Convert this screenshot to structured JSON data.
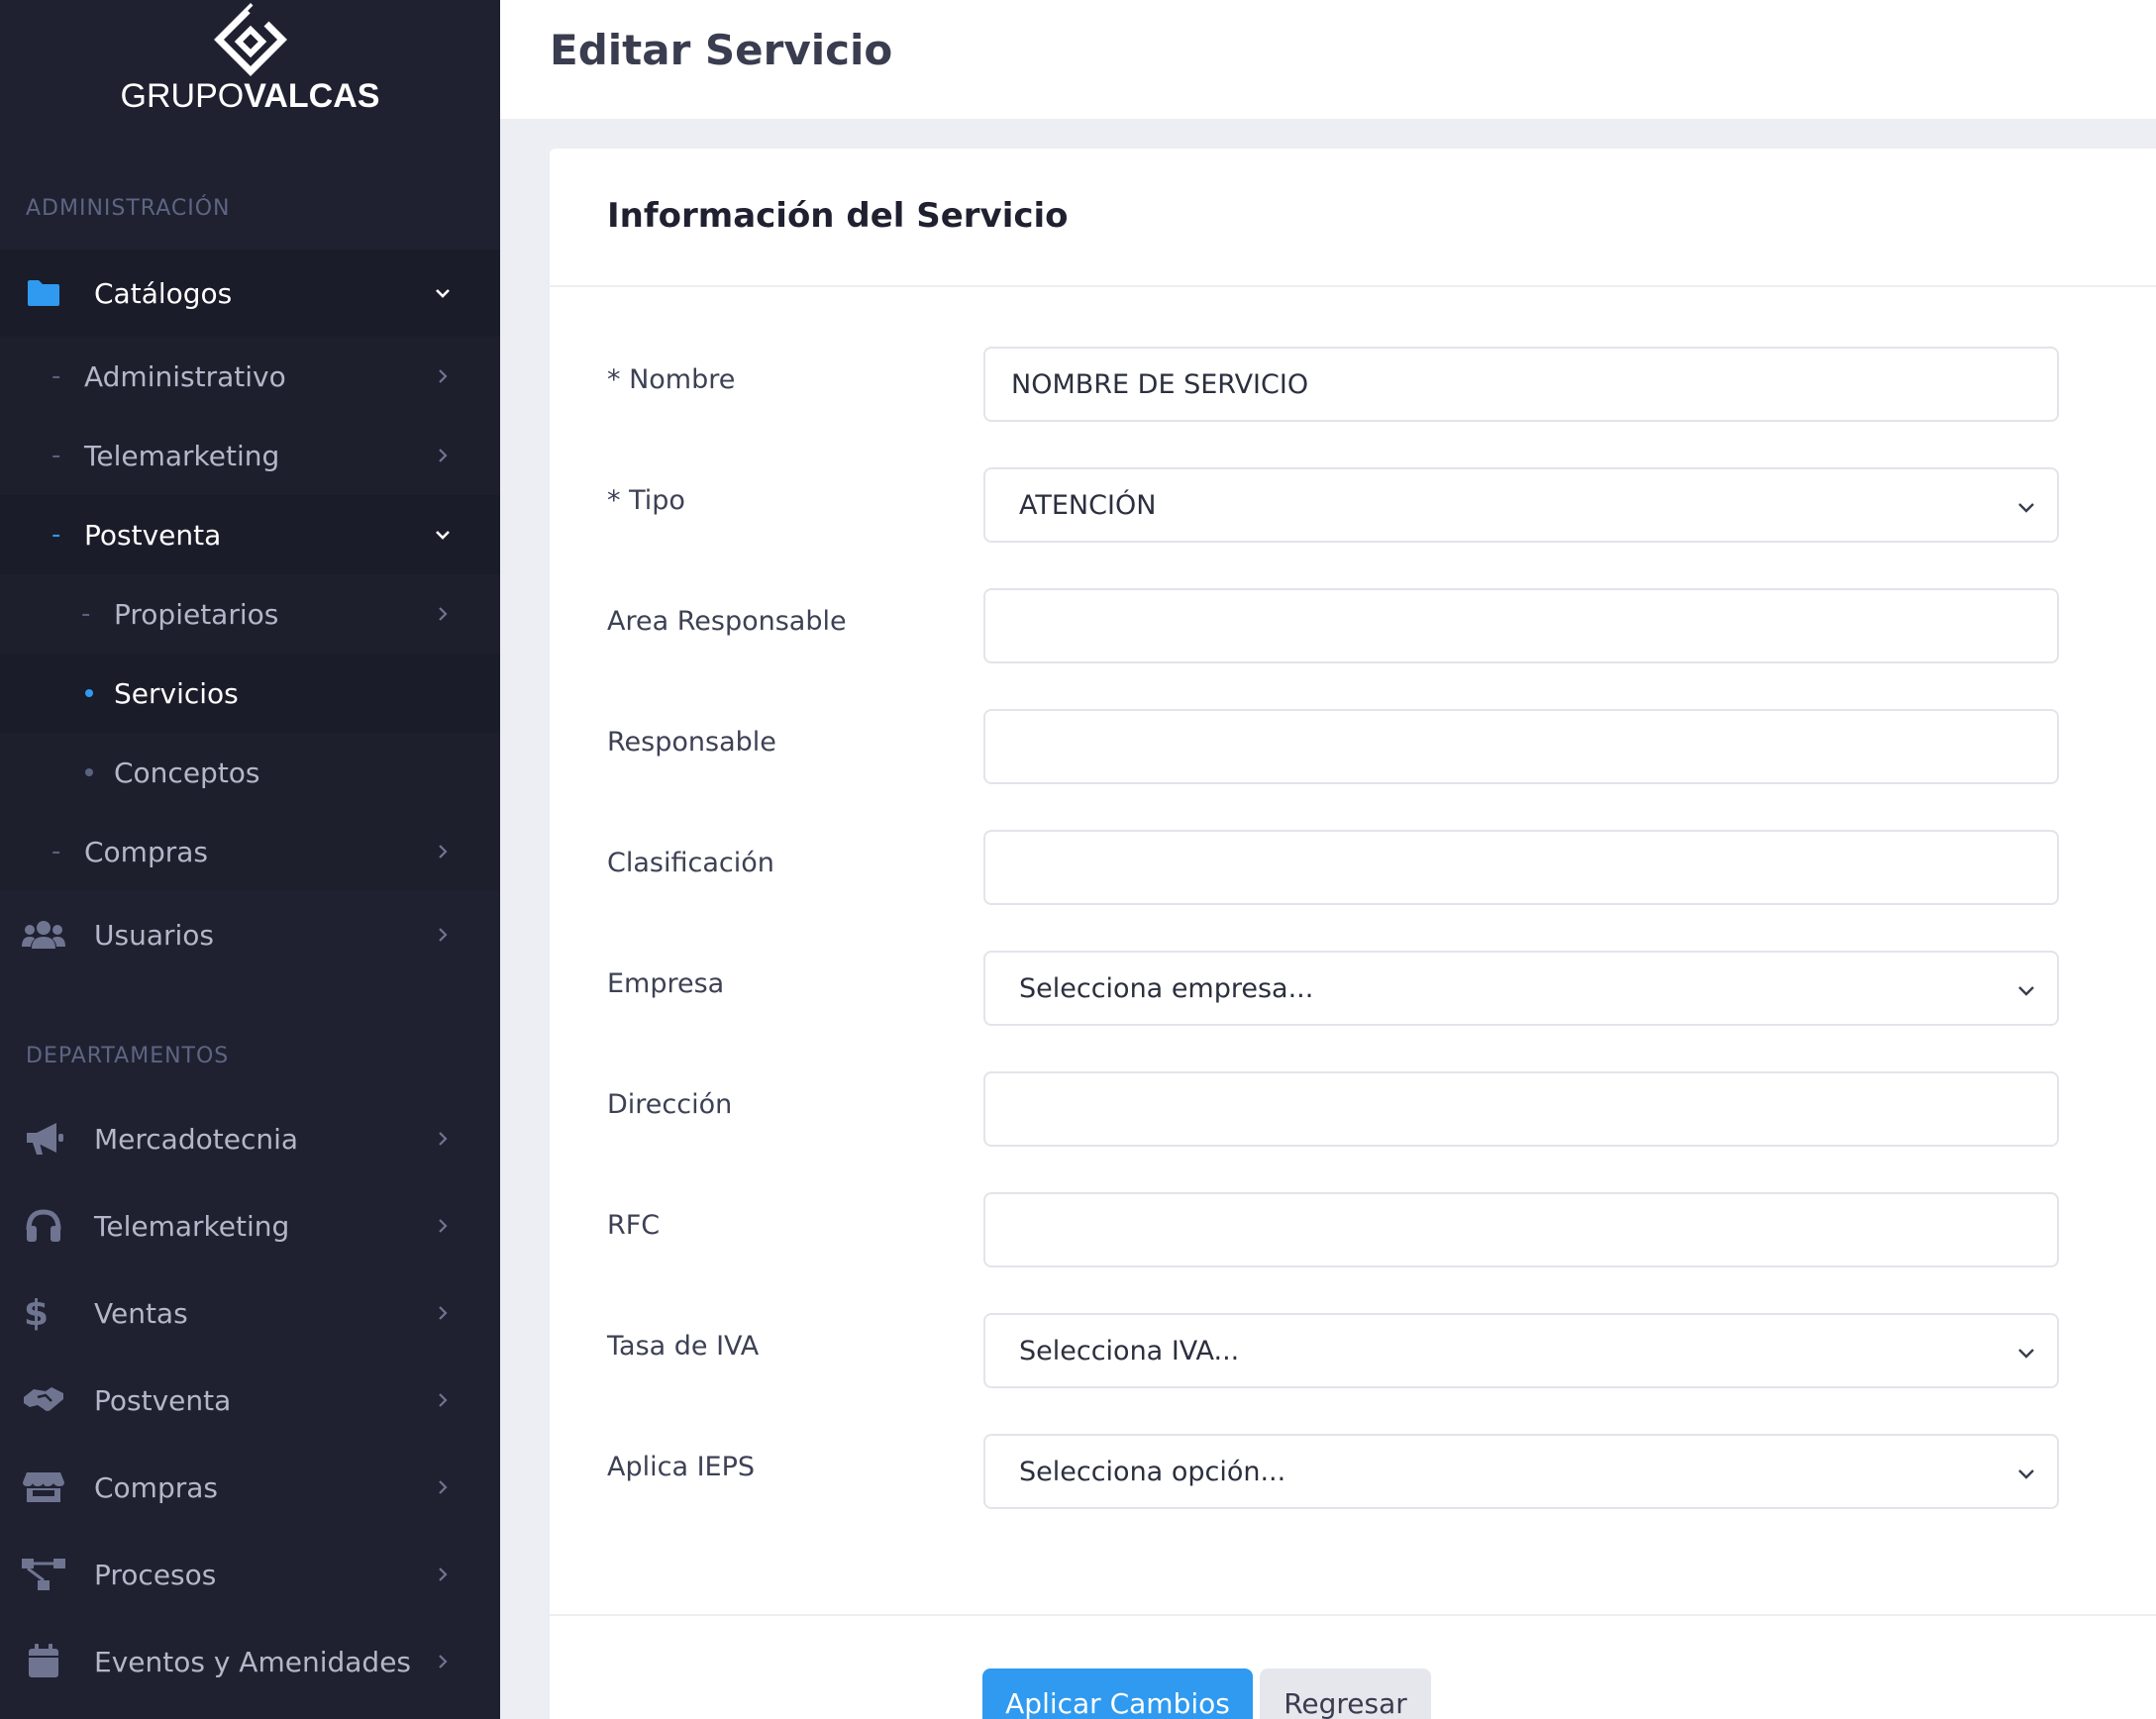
{
  "brand": {
    "name_light": "GRUPO",
    "name_bold": "VALCAS"
  },
  "sidebar": {
    "section_admin": "ADMINISTRACIÓN",
    "section_departments": "DEPARTAMENTOS",
    "catalogos": "Catálogos",
    "administrativo": "Administrativo",
    "telemarketing_sub": "Telemarketing",
    "postventa_sub": "Postventa",
    "propietarios": "Propietarios",
    "servicios": "Servicios",
    "conceptos": "Conceptos",
    "compras_sub": "Compras",
    "usuarios": "Usuarios",
    "mercadotecnia": "Mercadotecnia",
    "telemarketing": "Telemarketing",
    "ventas": "Ventas",
    "postventa": "Postventa",
    "compras": "Compras",
    "procesos": "Procesos",
    "eventos": "Eventos y Amenidades"
  },
  "header": {
    "title": "Editar Servicio"
  },
  "card": {
    "title": "Información del Servicio"
  },
  "form": {
    "nombre_label": "* Nombre",
    "nombre_value": "NOMBRE DE SERVICIO",
    "tipo_label": "* Tipo",
    "tipo_value": "ATENCIÓN",
    "area_label": "Area Responsable",
    "area_value": "",
    "responsable_label": "Responsable",
    "responsable_value": "",
    "clasificacion_label": "Clasificación",
    "clasificacion_value": "",
    "empresa_label": "Empresa",
    "empresa_value": "Selecciona empresa...",
    "direccion_label": "Dirección",
    "direccion_value": "",
    "rfc_label": "RFC",
    "rfc_value": "",
    "iva_label": "Tasa de IVA",
    "iva_value": "Selecciona IVA...",
    "ieps_label": "Aplica IEPS",
    "ieps_value": "Selecciona opción..."
  },
  "buttons": {
    "apply": "Aplicar Cambios",
    "back": "Regresar"
  },
  "colors": {
    "sidebar_bg": "#1f2130",
    "accent": "#2f9af0",
    "page_bg": "#eceef4"
  },
  "icons": {
    "catalogos": "folder-icon",
    "usuarios": "users-icon",
    "mercadotecnia": "megaphone-icon",
    "telemarketing": "headset-icon",
    "ventas": "dollar-icon",
    "postventa": "handshake-icon",
    "compras": "store-icon",
    "procesos": "sitemap-icon",
    "eventos": "calendar-icon"
  }
}
